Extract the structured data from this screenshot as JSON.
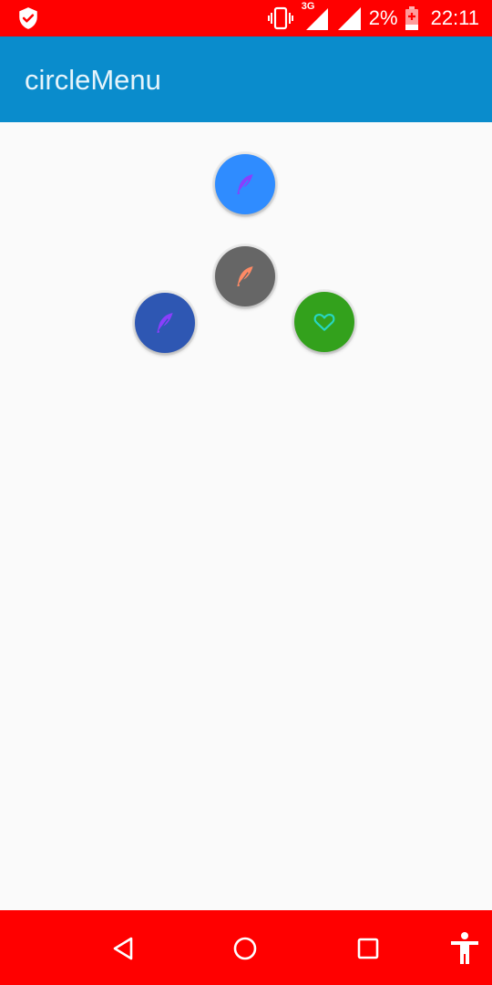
{
  "status_bar": {
    "battery_percent": "2%",
    "time": "22:11",
    "network_type": "3G",
    "icons": [
      "shield-icon",
      "vibrate-icon",
      "signal-3g-icon",
      "signal-icon",
      "battery-charging-icon"
    ],
    "bg_color": "#ff0000"
  },
  "app_bar": {
    "title": "circleMenu",
    "bg_color": "#0a8ccc"
  },
  "circle_menu": {
    "center_button": {
      "color": "#666666",
      "icon": "feather-icon",
      "icon_color": "#ff8a65"
    },
    "items": [
      {
        "id": "top",
        "color": "#2f8cff",
        "icon": "feather-icon",
        "icon_color": "#8a3ffc"
      },
      {
        "id": "left",
        "color": "#2e57b3",
        "icon": "feather-icon",
        "icon_color": "#8a3ffc"
      },
      {
        "id": "right",
        "color": "#33a11c",
        "icon": "heart-icon",
        "icon_color": "#28d6c2"
      }
    ]
  },
  "nav_bar": {
    "bg_color": "#ff0000",
    "buttons": [
      "back-icon",
      "home-icon",
      "recents-icon",
      "accessibility-icon"
    ]
  }
}
